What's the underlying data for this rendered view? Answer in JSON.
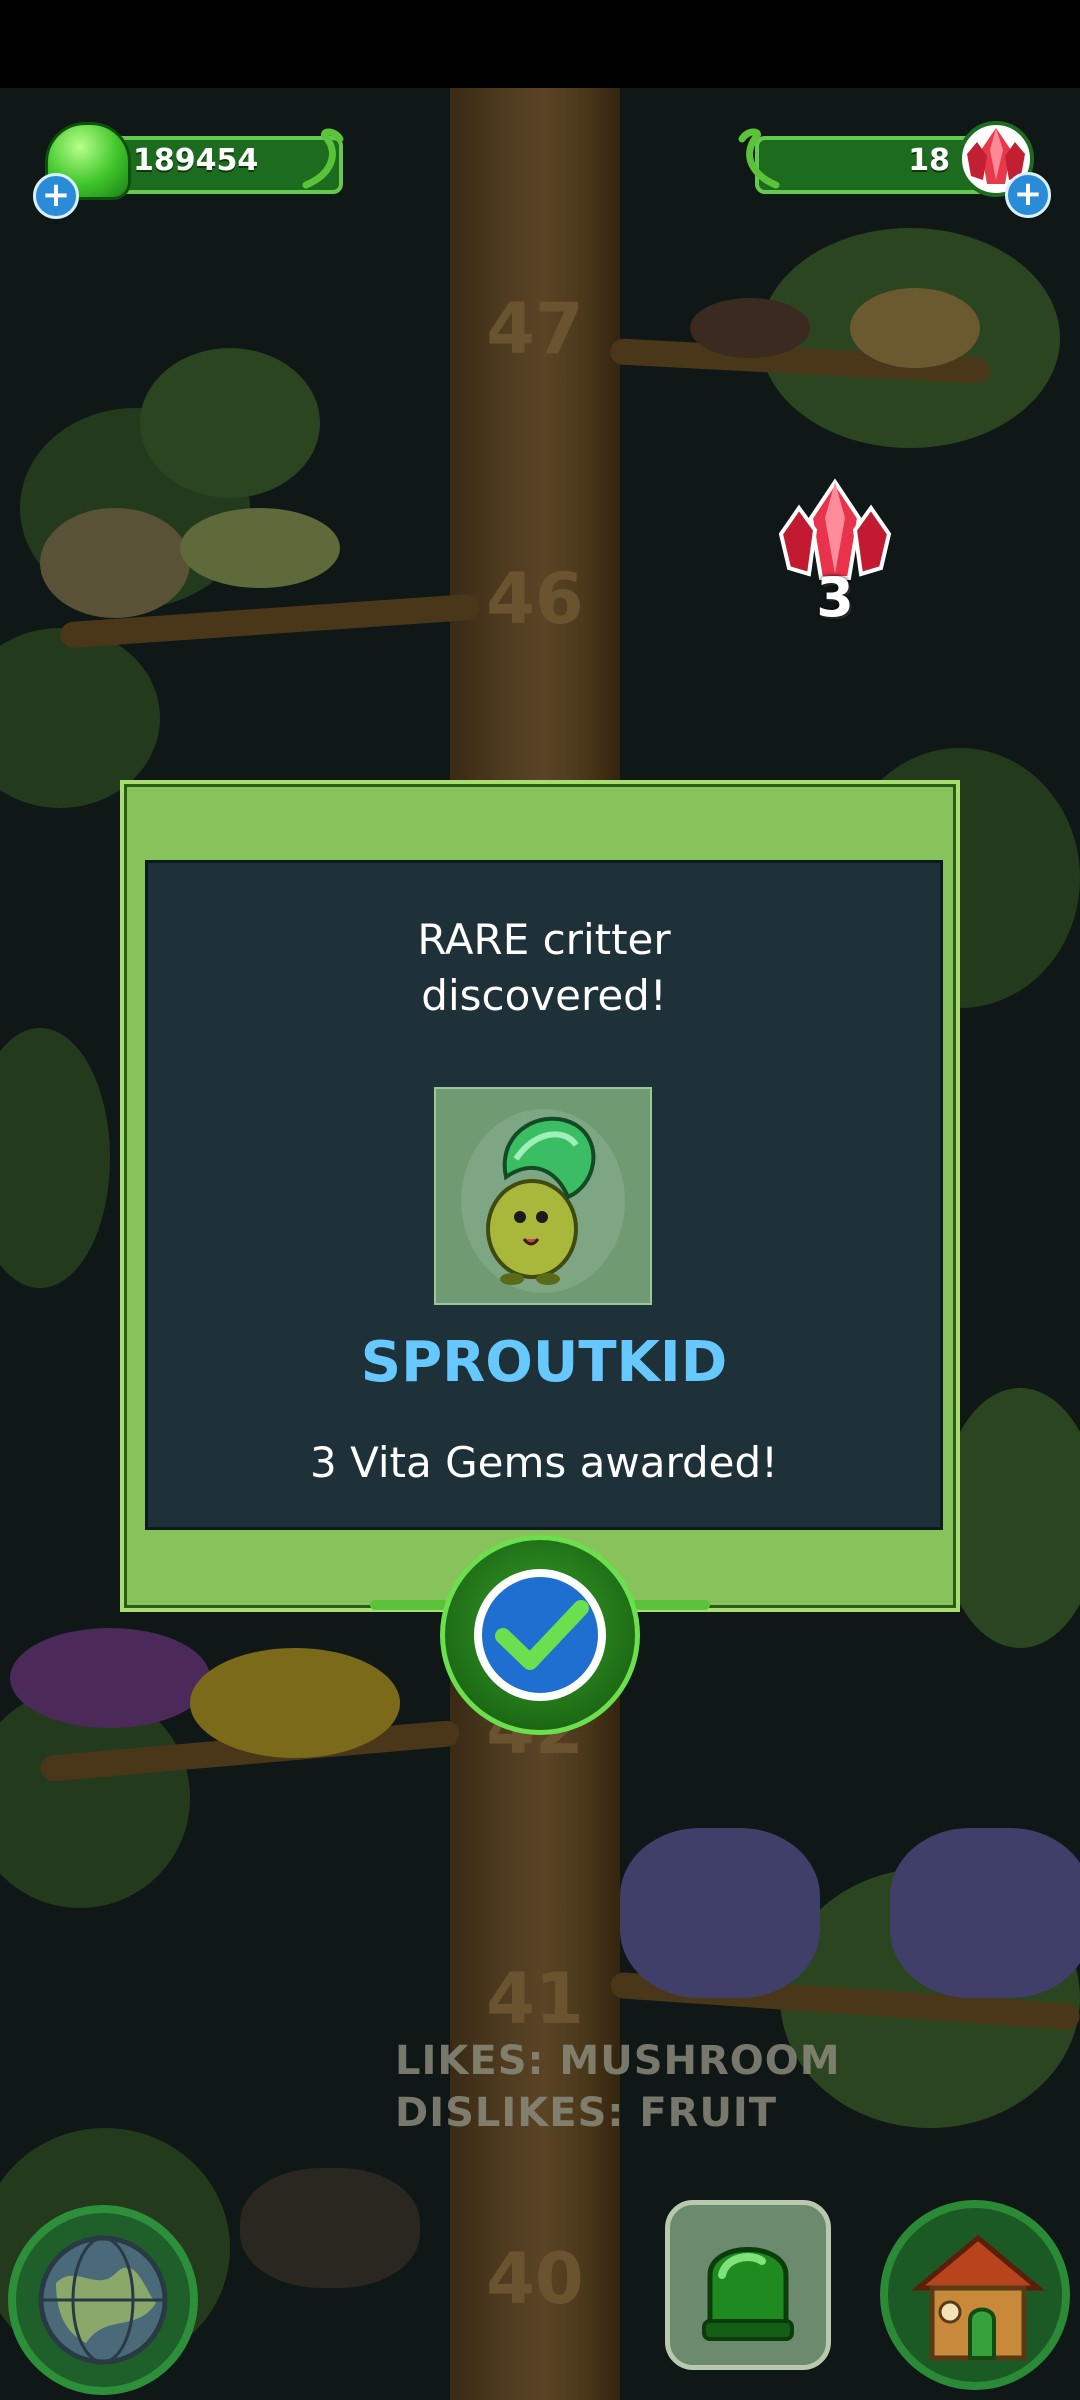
{
  "hud": {
    "jelly_count": "189454",
    "gem_count": "18",
    "jelly_icon": "green-jelly-icon",
    "gem_icon": "red-gem-icon",
    "add_icon": "plus-icon"
  },
  "tree": {
    "levels": [
      "47",
      "46",
      "42",
      "41",
      "40"
    ]
  },
  "floating_reward": {
    "icon": "red-gem-icon",
    "amount": "3"
  },
  "modal": {
    "title_line1": "RARE critter",
    "title_line2": "discovered!",
    "critter_name": "SPROUTKID",
    "award_text": "3 Vita Gems awarded!",
    "confirm_icon": "checkmark-icon"
  },
  "critter_info": {
    "likes": "LIKES: MUSHROOM",
    "dislikes": "DISLIKES: FRUIT"
  },
  "bottom_nav": {
    "world_icon": "globe-icon",
    "jelly_icon": "jelly-icon",
    "house_icon": "house-icon"
  },
  "colors": {
    "accent_green": "#88c25a",
    "name_blue": "#66c8ff",
    "panel_bg": "#1f3138"
  }
}
